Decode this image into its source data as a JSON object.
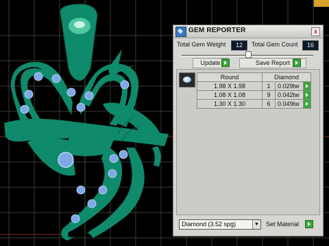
{
  "gem_reporter": {
    "title": "GEM REPORTER",
    "close_glyph": "x",
    "total_gem_weight_label": "Total Gem Weight",
    "total_gem_weight_value": "12",
    "total_gem_count_label": "Total Gem Count",
    "total_gem_count_value": "16",
    "update_label": "Update",
    "save_report_label": "Save Report",
    "table": {
      "columns": [
        "Round",
        "Diamond"
      ],
      "rows": [
        {
          "size": "1.98 X 1.98",
          "count": "1",
          "weight": "0.029tw"
        },
        {
          "size": "1.08 X 1.08",
          "count": "9",
          "weight": "0.042tw"
        },
        {
          "size": "1.30 X 1.30",
          "count": "6",
          "weight": "0.049tw"
        }
      ]
    },
    "material_value": "Diamond    (3.52 spg)",
    "material_dropdown_glyph": "▼",
    "set_material_label": "Set Material"
  },
  "colors": {
    "viewport_bg": "#000000",
    "grid": "#3a3a3a",
    "pendant": "#0f8a6a",
    "gem": "#7fa9e6",
    "panel_bg": "#d6d6d2",
    "go_button": "#3aa63a"
  },
  "icons": {
    "title": "gem-reporter-app-icon",
    "go": "green-arrow-icon",
    "gem_preview": "round-gem-icon"
  }
}
